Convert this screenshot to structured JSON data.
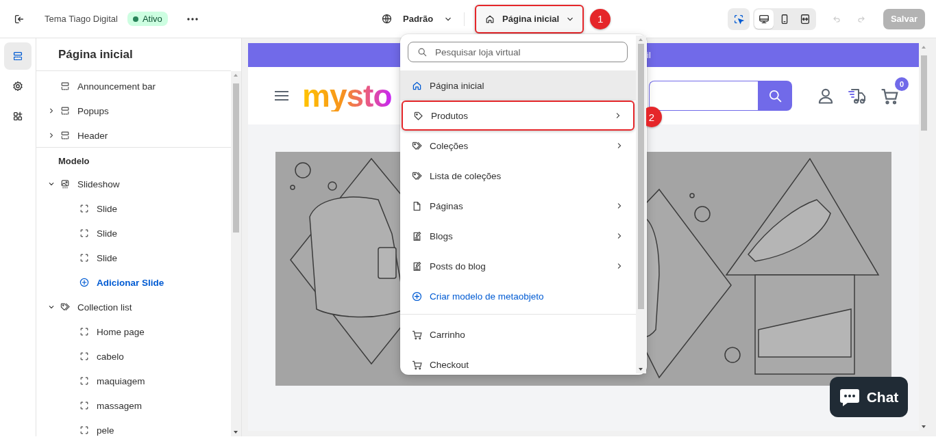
{
  "top_bar": {
    "theme": "Tema Tiago Digital",
    "status": "Ativo",
    "locale": {
      "label": "Padrão"
    },
    "page_selector": {
      "label": "Página inicial",
      "expanded": true,
      "callout": "1"
    },
    "inspector": {
      "on": true
    },
    "views": [
      {
        "kind": "desktop",
        "selected": true
      },
      {
        "kind": "mobile",
        "selected": false
      },
      {
        "kind": "full_width",
        "selected": false
      }
    ],
    "history": [
      {
        "kind": "undo",
        "disabled": true
      },
      {
        "kind": "redo",
        "disabled": true
      }
    ],
    "save": {
      "label": "Salvar",
      "disabled": true
    }
  },
  "rail": [
    {
      "kind": "sections",
      "selected": true
    },
    {
      "kind": "settings",
      "selected": false
    },
    {
      "kind": "apps",
      "selected": false
    }
  ],
  "sidebar": {
    "title": "Página inicial",
    "groups": [
      {
        "items": [
          {
            "label": "Announcement bar",
            "kind": "section"
          },
          {
            "label": "Popups",
            "kind": "section",
            "expanded": false
          },
          {
            "label": "Header",
            "kind": "section",
            "expanded": false
          }
        ]
      },
      {
        "heading": "Modelo",
        "items": [
          {
            "label": "Slideshow",
            "kind": "slideshow",
            "expanded": true,
            "children": [
              {
                "label": "Slide",
                "kind": "block"
              },
              {
                "label": "Slide",
                "kind": "block"
              },
              {
                "label": "Slide",
                "kind": "block"
              },
              {
                "label": "Adicionar Slide",
                "kind": "add"
              }
            ]
          },
          {
            "label": "Collection list",
            "kind": "collection",
            "expanded": true,
            "children": [
              {
                "label": "Home page",
                "kind": "block"
              },
              {
                "label": "cabelo",
                "kind": "block"
              },
              {
                "label": "maquiagem",
                "kind": "block"
              },
              {
                "label": "massagem",
                "kind": "block"
              },
              {
                "label": "pele",
                "kind": "block"
              }
            ]
          }
        ]
      }
    ]
  },
  "page_menu": {
    "search": {
      "placeholder": "Pesquisar loja virtual"
    },
    "items": [
      {
        "label": "Página inicial",
        "kind": "home",
        "selected": true,
        "submenu": false
      },
      {
        "label": "Produtos",
        "kind": "tag",
        "selected": false,
        "submenu": true,
        "callout": "2"
      },
      {
        "label": "Coleções",
        "kind": "collection",
        "selected": false,
        "submenu": true
      },
      {
        "label": "Lista de coleções",
        "kind": "collection",
        "selected": false,
        "submenu": false
      },
      {
        "label": "Páginas",
        "kind": "page",
        "selected": false,
        "submenu": true
      },
      {
        "label": "Blogs",
        "kind": "blog",
        "selected": false,
        "submenu": true
      },
      {
        "label": "Posts do blog",
        "kind": "blog",
        "selected": false,
        "submenu": true
      },
      {
        "label": "Criar modelo de metaobjeto",
        "kind": "add",
        "selected": false,
        "submenu": false
      }
    ],
    "system_items": [
      {
        "label": "Carrinho",
        "kind": "cart",
        "selected": false,
        "submenu": false
      },
      {
        "label": "Checkout",
        "kind": "cart",
        "selected": false,
        "submenu": false
      }
    ]
  },
  "preview": {
    "announcement": "il",
    "logo": "mysto",
    "cart_count": "0",
    "chat": "Chat"
  }
}
